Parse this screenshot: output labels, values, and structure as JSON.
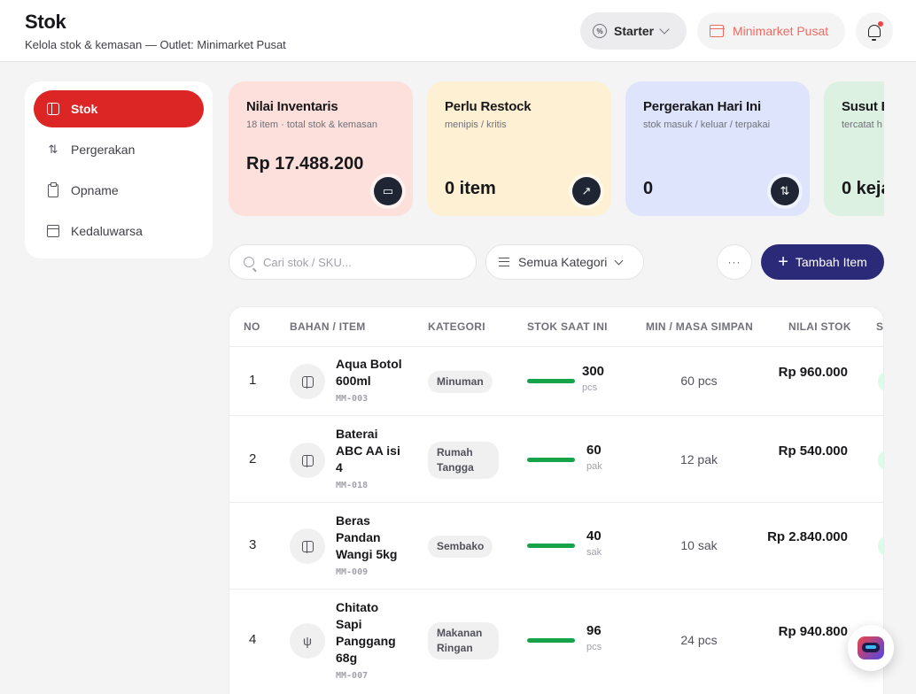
{
  "header": {
    "title": "Stok",
    "subtitle": "Kelola stok & kemasan — Outlet: Minimarket Pusat",
    "plan_label": "Starter",
    "outlet_label": "Minimarket Pusat"
  },
  "sidebar": {
    "items": [
      {
        "label": "Stok",
        "active": true
      },
      {
        "label": "Pergerakan",
        "active": false
      },
      {
        "label": "Opname",
        "active": false
      },
      {
        "label": "Kedaluwarsa",
        "active": false
      }
    ]
  },
  "cards": [
    {
      "title": "Nilai Inventaris",
      "sub": "18 item · total stok & kemasan",
      "value": "Rp 17.488.200",
      "color": "#fde0dc",
      "icon": "wallet-icon"
    },
    {
      "title": "Perlu Restock",
      "sub": "menipis / kritis",
      "value": "0 item",
      "color": "#fdf0d3",
      "icon": "arrow-up-right-icon"
    },
    {
      "title": "Pergerakan Hari Ini",
      "sub": "stok masuk / keluar / terpakai",
      "value": "0",
      "color": "#dde4fb",
      "icon": "swap-vertical-icon"
    },
    {
      "title": "Susut B",
      "sub": "tercatat h",
      "value": "0 keja",
      "color": "#ddf1e2",
      "icon": ""
    }
  ],
  "toolbar": {
    "search_placeholder": "Cari stok / SKU...",
    "category_label": "Semua Kategori",
    "more_label": "···",
    "add_label": "Tambah Item"
  },
  "table": {
    "headers": [
      "NO",
      "BAHAN / ITEM",
      "KATEGORI",
      "STOK SAAT INI",
      "MIN / MASA SIMPAN",
      "NILAI STOK",
      "S"
    ],
    "rows": [
      {
        "no": "1",
        "name": "Aqua Botol 600ml",
        "sku": "MM-003",
        "category": "Minuman",
        "stock": "300",
        "unit": "pcs",
        "min": "60 pcs",
        "value": "Rp 960.000",
        "icon": "box-icon"
      },
      {
        "no": "2",
        "name": "Baterai ABC AA isi 4",
        "sku": "MM-018",
        "category": "Rumah Tangga",
        "stock": "60",
        "unit": "pak",
        "min": "12 pak",
        "value": "Rp 540.000",
        "icon": "box-icon"
      },
      {
        "no": "3",
        "name": "Beras Pandan Wangi 5kg",
        "sku": "MM-009",
        "category": "Sembako",
        "stock": "40",
        "unit": "sak",
        "min": "10 sak",
        "value": "Rp 2.840.000",
        "icon": "box-icon"
      },
      {
        "no": "4",
        "name": "Chitato Sapi Panggang 68g",
        "sku": "MM-007",
        "category": "Makanan Ringan",
        "stock": "96",
        "unit": "pcs",
        "min": "24 pcs",
        "value": "Rp 940.800",
        "icon": "fork-knife-icon"
      }
    ]
  },
  "colors": {
    "accent": "#dc2626",
    "primary_button": "#2b2a78",
    "stock_ok": "#16a34a"
  }
}
